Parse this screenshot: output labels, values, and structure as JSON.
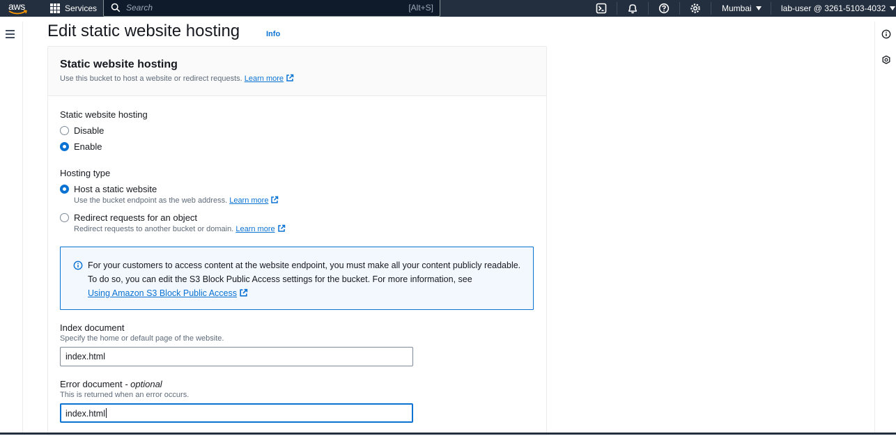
{
  "topbar": {
    "logo_text": "aws",
    "services_label": "Services",
    "search_placeholder": "Search",
    "search_shortcut": "[Alt+S]",
    "region_label": "Mumbai",
    "user_label": "lab-user @ 3261-5103-4032"
  },
  "page": {
    "title": "Edit static website hosting",
    "info_label": "Info"
  },
  "panel": {
    "title": "Static website hosting",
    "description": "Use this bucket to host a website or redirect requests.",
    "learn_more": "Learn more"
  },
  "hosting_toggle": {
    "label": "Static website hosting",
    "options": [
      {
        "label": "Disable",
        "selected": false
      },
      {
        "label": "Enable",
        "selected": true
      }
    ]
  },
  "hosting_type": {
    "label": "Hosting type",
    "options": [
      {
        "label": "Host a static website",
        "description": "Use the bucket endpoint as the web address.",
        "link": "Learn more",
        "selected": true
      },
      {
        "label": "Redirect requests for an object",
        "description": "Redirect requests to another bucket or domain.",
        "link": "Learn more",
        "selected": false
      }
    ]
  },
  "alert": {
    "text": "For your customers to access content at the website endpoint, you must make all your content publicly readable. To do so, you can edit the S3 Block Public Access settings for the bucket. For more information, see",
    "link": "Using Amazon S3 Block Public Access"
  },
  "index_document": {
    "label": "Index document",
    "description": "Specify the home or default page of the website.",
    "value": "index.html"
  },
  "error_document": {
    "label": "Error document",
    "optional": "- optional",
    "description": "This is returned when an error occurs.",
    "value": "index.html"
  },
  "colors": {
    "topbar": "#232f3e",
    "accent": "#0972d3",
    "alert_bg": "#f2f8fd"
  }
}
